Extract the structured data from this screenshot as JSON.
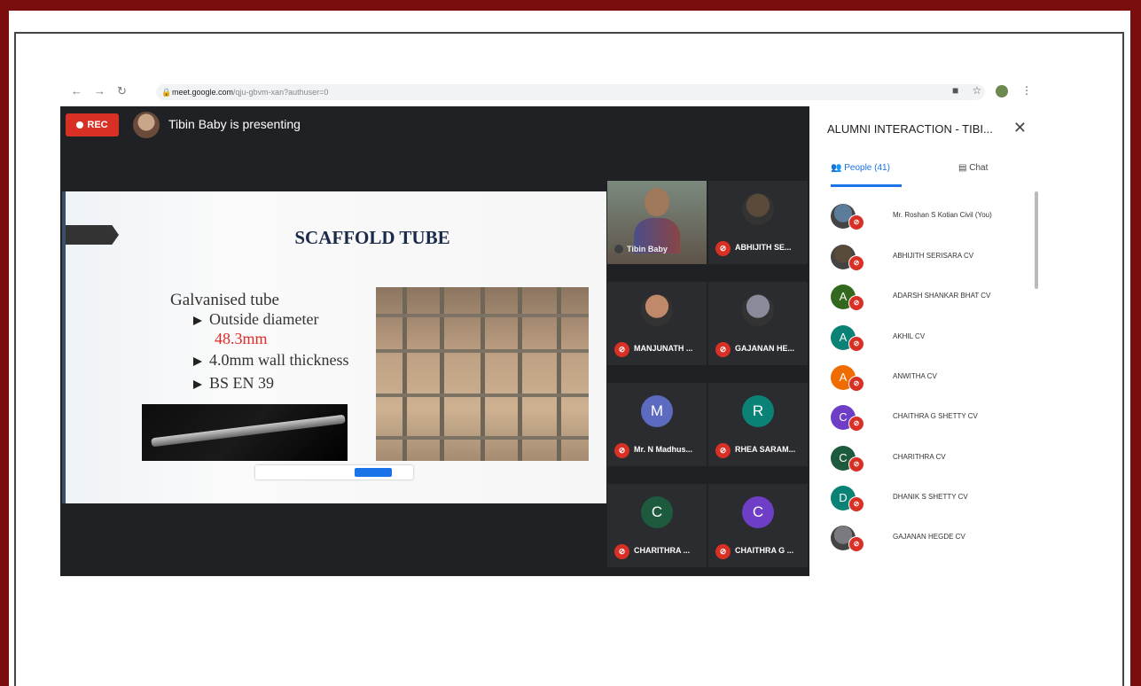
{
  "browser": {
    "url_host": "meet.google.com",
    "url_path": "/qju-gbvm-xan?authuser=0"
  },
  "meet": {
    "rec_label": "REC",
    "presenting_text": "Tibin Baby is presenting"
  },
  "slide": {
    "title": "SCAFFOLD TUBE",
    "heading": "Galvanised tube",
    "bullets": [
      "Outside diameter",
      "4.0mm wall thickness",
      "BS EN 39"
    ],
    "diameter_value": "48.3mm"
  },
  "tiles": [
    {
      "name": "Tibin Baby",
      "type": "camera"
    },
    {
      "name": "ABHIJITH SE...",
      "type": "photo",
      "color": "#5a4a3a"
    },
    {
      "name": "MANJUNATH ...",
      "type": "photo",
      "color": "#c08a6a"
    },
    {
      "name": "GAJANAN HE...",
      "type": "photo",
      "color": "#8a8a9a"
    },
    {
      "name": "Mr. N Madhus...",
      "type": "letter",
      "letter": "M",
      "color": "#5c6bc0"
    },
    {
      "name": "RHEA SARAM...",
      "type": "letter",
      "letter": "R",
      "color": "#0b8276"
    },
    {
      "name": "CHARITHRA ...",
      "type": "letter",
      "letter": "C",
      "color": "#1e5a3e"
    },
    {
      "name": "CHAITHRA G ...",
      "type": "letter",
      "letter": "C",
      "color": "#6e3ec6"
    }
  ],
  "panel": {
    "title": "ALUMNI INTERACTION - TIBI...",
    "tab_people": "People (41)",
    "tab_chat": "Chat",
    "people": [
      {
        "name": "Mr. Roshan S Kotian Civil (You)",
        "type": "photo",
        "color": "#5c7d9a"
      },
      {
        "name": "ABHIJITH SERISARA CV",
        "type": "photo",
        "color": "#5a4a3a"
      },
      {
        "name": "ADARSH SHANKAR BHAT CV",
        "type": "letter",
        "letter": "A",
        "color": "#33691e"
      },
      {
        "name": "AKHIL CV",
        "type": "letter",
        "letter": "A",
        "color": "#0b8276"
      },
      {
        "name": "ANWITHA CV",
        "type": "letter",
        "letter": "A",
        "color": "#ef6c00"
      },
      {
        "name": "CHAITHRA G SHETTY CV",
        "type": "letter",
        "letter": "C",
        "color": "#6e3ec6"
      },
      {
        "name": "CHARITHRA CV",
        "type": "letter",
        "letter": "C",
        "color": "#1e5a3e"
      },
      {
        "name": "DHANIK S SHETTY CV",
        "type": "letter",
        "letter": "D",
        "color": "#0b8276"
      },
      {
        "name": "GAJANAN HEGDE CV",
        "type": "photo",
        "color": "#7a7a80"
      }
    ]
  },
  "colors": {
    "frame": "#7a0d0d",
    "meet_bg": "#202124",
    "accent": "#1a73e8",
    "rec": "#d93025"
  }
}
